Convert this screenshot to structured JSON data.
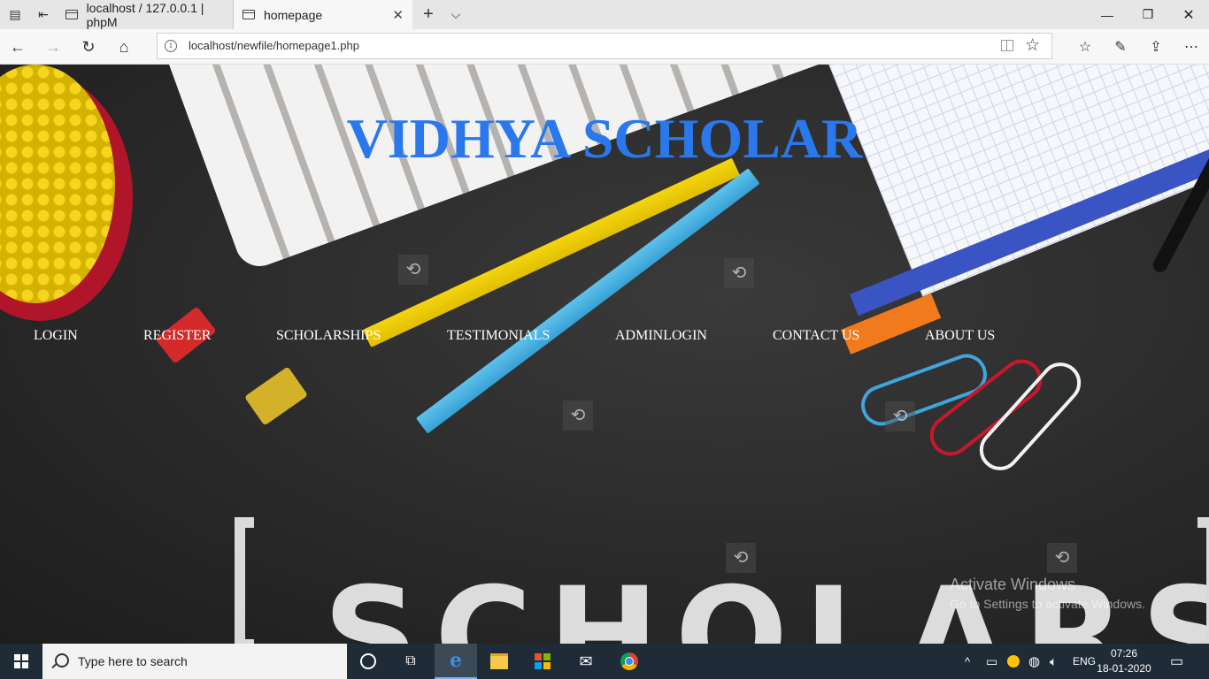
{
  "browser": {
    "tabs": [
      {
        "title": "localhost / 127.0.0.1 | phpM",
        "active": false
      },
      {
        "title": "homepage",
        "active": true
      }
    ],
    "url": "localhost/newfile/homepage1.php"
  },
  "site": {
    "title": "VIDHYA SCHOLAR",
    "nav": [
      "LOGIN",
      "REGISTER",
      "SCHOLARSHIPS",
      "TESTIMONIALS",
      "ADMINLOGIN",
      "CONTACT US",
      "ABOUT US"
    ],
    "hero_text": "SCHOLARSHIP"
  },
  "activation": {
    "title": "Activate Windows",
    "subtitle": "Go to Settings to activate Windows."
  },
  "taskbar": {
    "search_placeholder": "Type here to search",
    "language": "ENG",
    "time": "07:26",
    "date": "18-01-2020"
  },
  "colors": {
    "title_blue": "#2b78ec",
    "taskbar": "#1f2b36"
  }
}
